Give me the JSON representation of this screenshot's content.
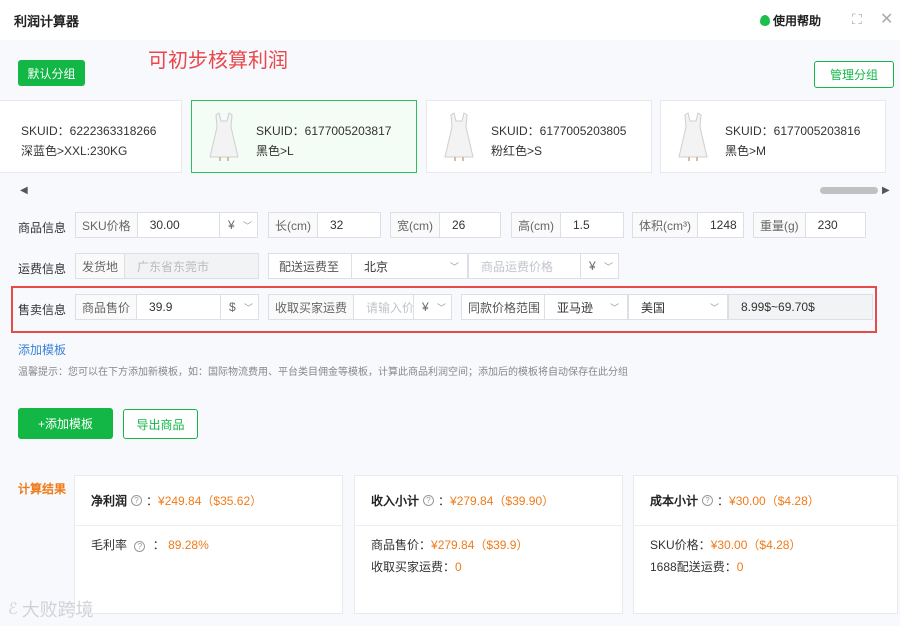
{
  "window": {
    "title": "利润计算器",
    "help_label": "使用帮助"
  },
  "buttons": {
    "default_group": "默认分组",
    "manage_group": "管理分组",
    "add_template": "+添加模板",
    "export_goods": "导出商品"
  },
  "annotation_text": "可初步核算利润",
  "skus": [
    {
      "id": "SKUID：6222363318266",
      "variant": "深蓝色>XXL:230KG",
      "selected": false
    },
    {
      "id": "SKUID：6177005203817",
      "variant": "黑色>L",
      "selected": true
    },
    {
      "id": "SKUID：6177005203805",
      "variant": "粉红色>S",
      "selected": false
    },
    {
      "id": "SKUID：6177005203816",
      "variant": "黑色>M",
      "selected": false
    }
  ],
  "product_info": {
    "label": "商品信息",
    "sku_price_label": "SKU价格",
    "sku_price": "30.00",
    "currency": "¥",
    "length_label": "长(cm)",
    "length": "32",
    "width_label": "宽(cm)",
    "width": "26",
    "height_label": "高(cm)",
    "height": "1.5",
    "volume_label": "体积(cm³)",
    "volume": "1248",
    "weight_label": "重量(g)",
    "weight": "230"
  },
  "shipping_info": {
    "label": "运费信息",
    "origin_label": "发货地",
    "origin_value": "广东省东莞市",
    "ship_to_label": "配送运费至",
    "ship_to_value": "北京",
    "shipping_price_placeholder": "商品运费价格",
    "currency": "¥"
  },
  "sale_info": {
    "label": "售卖信息",
    "price_label": "商品售价",
    "price": "39.9",
    "price_currency": "$",
    "buyer_freight_label": "收取买家运费",
    "buyer_freight_placeholder": "请输入价",
    "freight_currency": "¥",
    "same_range_label": "同款价格范围",
    "platform": "亚马逊",
    "country": "美国",
    "range": "8.99$~69.70$"
  },
  "add_template_link": "添加模板",
  "tip_text": "温馨提示：您可以在下方添加新模板，如：国际物流费用、平台类目佣金等模板，计算此商品利润空间；添加后的模板将自动保存在此分组",
  "results": {
    "label": "计算结果",
    "net_profit": {
      "title": "净利润",
      "value": "¥249.84（$35.62）",
      "margin_label": "毛利率",
      "margin_value": "89.28%"
    },
    "income": {
      "title": "收入小计",
      "value": "¥279.84（$39.90）",
      "price_label": "商品售价：",
      "price_value": "¥279.84（$39.9）",
      "freight_label": "收取买家运费：",
      "freight_value": "0"
    },
    "cost": {
      "title": "成本小计",
      "value": "¥30.00（$4.28）",
      "sku_label": "SKU价格：",
      "sku_value": "¥30.00（$4.28）",
      "ship_label": "1688配送运费：",
      "ship_value": "0"
    }
  },
  "watermark": "大败跨境",
  "colors": {
    "accent": "#12b745",
    "highlight_box": "#e84a4a",
    "orange": "#f07b1a",
    "link": "#3b82d8"
  }
}
